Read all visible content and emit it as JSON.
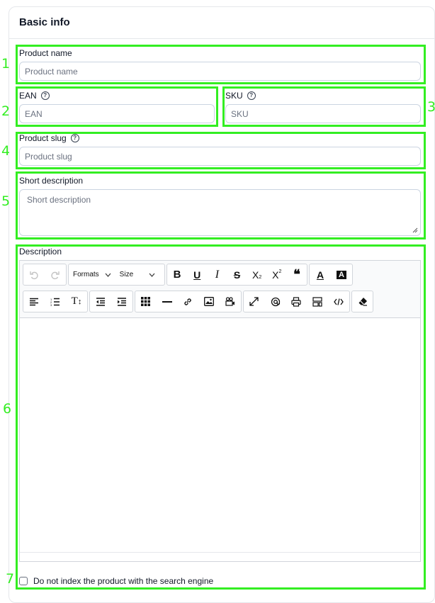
{
  "card": {
    "title": "Basic info"
  },
  "annotations": [
    "1",
    "2",
    "3",
    "4",
    "5",
    "6",
    "7"
  ],
  "fields": {
    "product_name": {
      "label": "Product name",
      "placeholder": "Product name"
    },
    "ean": {
      "label": "EAN",
      "placeholder": "EAN"
    },
    "sku": {
      "label": "SKU",
      "placeholder": "SKU"
    },
    "slug": {
      "label": "Product slug",
      "placeholder": "Product slug"
    },
    "short_description": {
      "label": "Short description",
      "placeholder": "Short description"
    },
    "description": {
      "label": "Description"
    }
  },
  "toolbar": {
    "formats_label": "Formats",
    "size_label": "Size",
    "bold": "B",
    "underline": "U",
    "italic": "I",
    "strike": "S",
    "subscript": "X",
    "superscript": "X",
    "quote": "❝",
    "font_color": "A",
    "highlight": "A",
    "line_height": "T"
  },
  "noindex": {
    "label": "Do not index the product with the search engine",
    "checked": false
  },
  "colors": {
    "annotation": "#33ee22",
    "border": "#cbd5e1"
  }
}
